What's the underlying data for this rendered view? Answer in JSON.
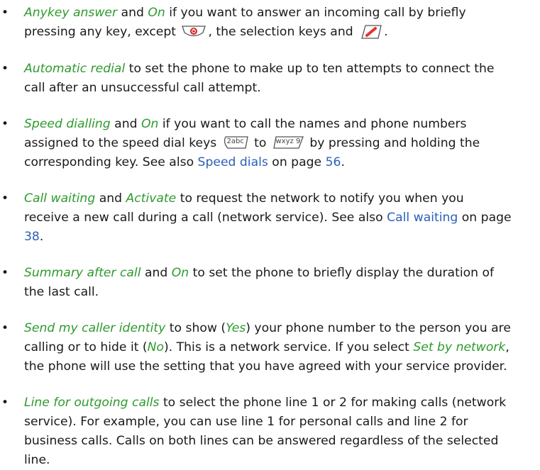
{
  "items": [
    {
      "term": "Anykey answer",
      "and": " and ",
      "option": "On",
      "text_a": " if you want to answer an incoming call by briefly",
      "text_b": "pressing any key, except ",
      "text_c": ", the selection keys and ",
      "text_d": ".",
      "icons": [
        "end-call-key-icon",
        "call-key-icon"
      ]
    },
    {
      "term": "Automatic redial",
      "text_a": " to set the phone to make up to ten attempts to connect the",
      "text_b": "call after an unsuccessful call attempt."
    },
    {
      "term": "Speed dialling",
      "and": " and ",
      "option": "On",
      "text_a": " if you want to call the names and phone numbers",
      "text_b": "assigned to the speed dial keys ",
      "key_from": "2abc",
      "to": " to ",
      "key_to": "wxyz 9",
      "text_c": " by pressing and holding the",
      "text_d": "corresponding key. See also ",
      "link": "Speed dials",
      "text_e": " on page ",
      "page": "56",
      "text_f": ".",
      "icons": [
        "key-2-icon",
        "key-9-icon"
      ]
    },
    {
      "term": "Call waiting",
      "and": " and ",
      "option": "Activate",
      "text_a": " to request the network to notify you when you",
      "text_b": "receive a new call during a call (network service). See also ",
      "link": "Call waiting",
      "text_c": " on page",
      "page": "38",
      "text_d": "."
    },
    {
      "term": "Summary after call",
      "and": " and ",
      "option": "On",
      "text_a": " to set the phone to briefly display the duration of",
      "text_b": "the last call."
    },
    {
      "term": "Send my caller identity",
      "text_a": " to show (",
      "opt_yes": "Yes",
      "text_b": ") your phone number to the person you are",
      "text_c": "calling or to hide it (",
      "opt_no": "No",
      "text_d": "). This is a network service. If you select ",
      "opt_net": "Set by network",
      "text_e": ",",
      "text_f": "the phone will use the setting that you have agreed with your service provider."
    },
    {
      "term": "Line for outgoing calls",
      "text_a": " to select the phone line 1 or 2 for making calls (network",
      "text_b": "service). For example, you can use line 1 for personal calls and line 2 for",
      "text_c": "business calls. Calls on both lines can be answered regardless of the selected",
      "text_d": "line."
    }
  ],
  "bullet": "•",
  "colors": {
    "term": "#2e9a2e",
    "link": "#2c5fb8",
    "text": "#1a1a1a"
  }
}
